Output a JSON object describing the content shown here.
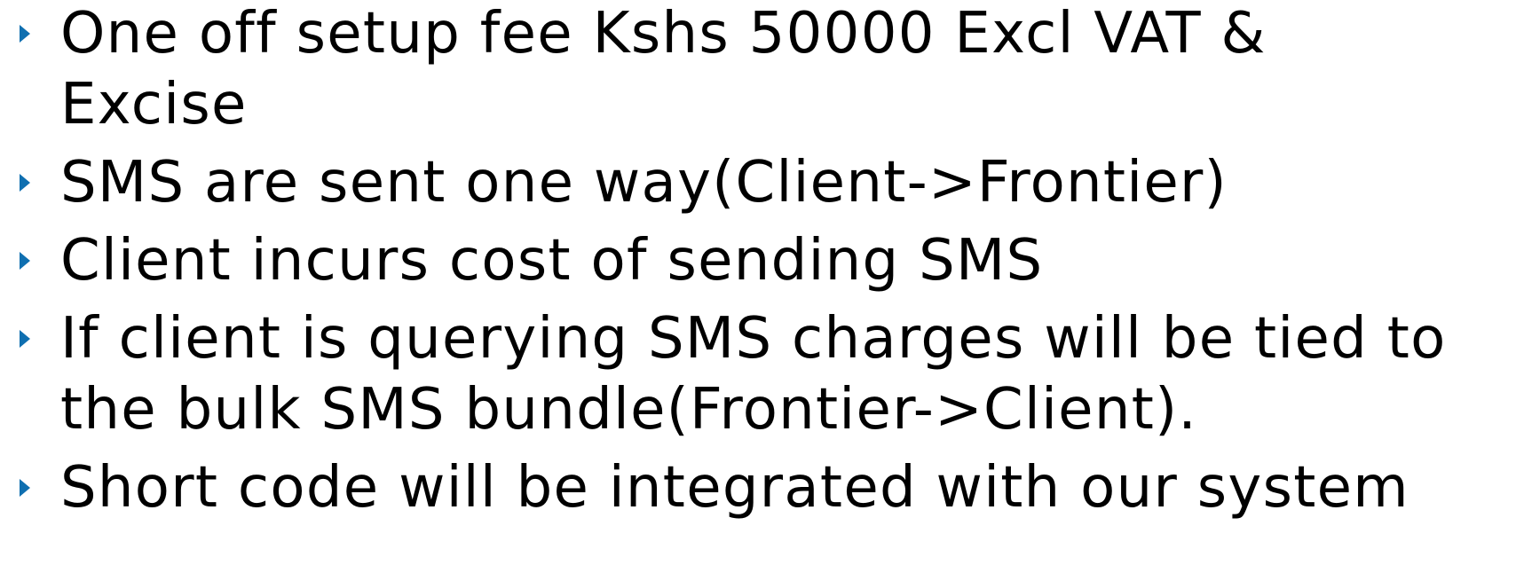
{
  "slide": {
    "bullet_color": "#0f6fb0",
    "bullet_icon": "triangle-right-icon",
    "bullets": [
      {
        "lines": [
          "One off setup fee Kshs 50000 Excl VAT &",
          "Excise"
        ]
      },
      {
        "lines": [
          "SMS are sent one way(Client->Frontier)"
        ]
      },
      {
        "lines": [
          "Client incurs cost of sending SMS"
        ]
      },
      {
        "lines": [
          "If client is querying SMS charges will be tied to",
          "the bulk SMS bundle(Frontier->Client)."
        ]
      },
      {
        "lines": [
          "Short code will be integrated with our system"
        ]
      }
    ]
  }
}
